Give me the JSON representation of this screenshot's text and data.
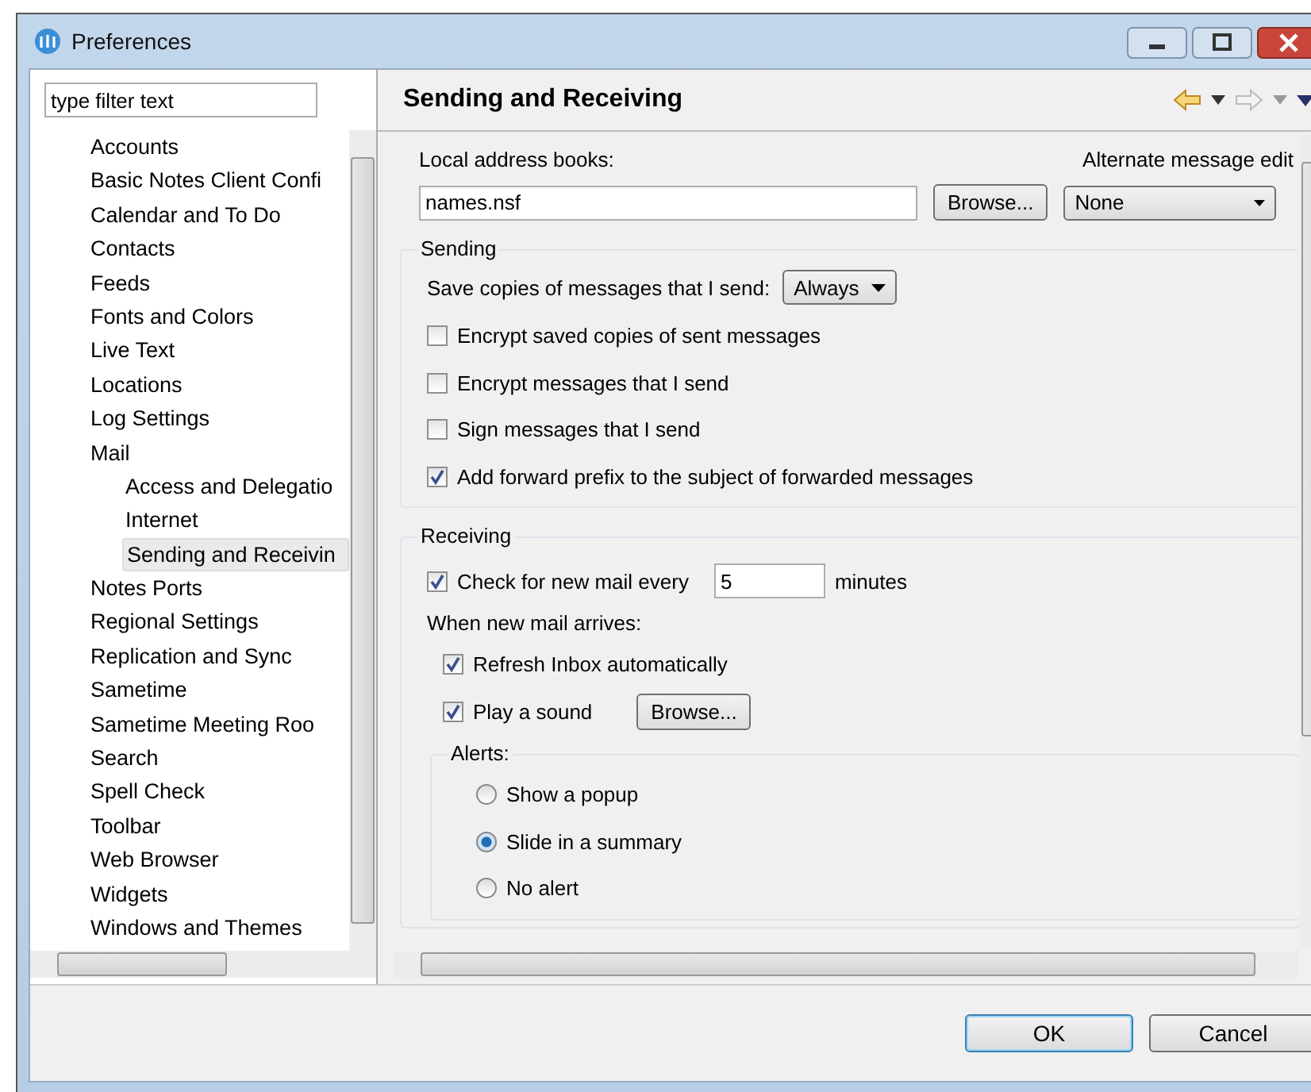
{
  "window": {
    "title": "Preferences"
  },
  "filter": {
    "placeholder": "type filter text"
  },
  "tree": [
    {
      "label": "Accounts",
      "selected": false
    },
    {
      "label": "Basic Notes Client Confi",
      "selected": false
    },
    {
      "label": "Calendar and To Do",
      "selected": false
    },
    {
      "label": "Contacts",
      "selected": false
    },
    {
      "label": "Feeds",
      "selected": false
    },
    {
      "label": "Fonts and Colors",
      "selected": false
    },
    {
      "label": "Live Text",
      "selected": false
    },
    {
      "label": "Locations",
      "selected": false
    },
    {
      "label": "Log Settings",
      "selected": false
    },
    {
      "label": "Mail",
      "selected": false,
      "children": [
        {
          "label": "Access and Delegatio",
          "selected": false
        },
        {
          "label": "Internet",
          "selected": false
        },
        {
          "label": "Sending and Receivin",
          "selected": true
        }
      ]
    },
    {
      "label": "Notes Ports",
      "selected": false
    },
    {
      "label": "Regional Settings",
      "selected": false
    },
    {
      "label": "Replication and Sync",
      "selected": false
    },
    {
      "label": "Sametime",
      "selected": false
    },
    {
      "label": "Sametime Meeting Roo",
      "selected": false
    },
    {
      "label": "Search",
      "selected": false
    },
    {
      "label": "Spell Check",
      "selected": false
    },
    {
      "label": "Toolbar",
      "selected": false
    },
    {
      "label": "Web Browser",
      "selected": false
    },
    {
      "label": "Widgets",
      "selected": false
    },
    {
      "label": "Windows and Themes",
      "selected": false
    }
  ],
  "page": {
    "title": "Sending and Receiving",
    "address": {
      "label": "Local address books:",
      "value": "names.nsf",
      "browse": "Browse...",
      "editor_label": "Alternate message edit",
      "editor_value": "None"
    },
    "sending": {
      "legend": "Sending",
      "save_label": "Save copies of messages that I send:",
      "save_value": "Always",
      "options": [
        {
          "label": "Encrypt saved copies of sent messages",
          "checked": false
        },
        {
          "label": "Encrypt messages that I send",
          "checked": false
        },
        {
          "label": "Sign messages that I send",
          "checked": false
        },
        {
          "label": "Add forward prefix to the subject of forwarded messages",
          "checked": true
        }
      ]
    },
    "receiving": {
      "legend": "Receiving",
      "check": {
        "label": "Check for new mail every",
        "checked": true,
        "value": "5",
        "unit": "minutes"
      },
      "arrives_label": "When new mail arrives:",
      "refresh": {
        "label": "Refresh Inbox automatically",
        "checked": true
      },
      "sound": {
        "label": "Play a sound",
        "checked": true,
        "browse": "Browse..."
      },
      "alerts": {
        "legend": "Alerts:",
        "options": [
          {
            "label": "Show a popup",
            "selected": false
          },
          {
            "label": "Slide in a summary",
            "selected": true
          },
          {
            "label": "No alert",
            "selected": false
          }
        ]
      }
    }
  },
  "buttons": [
    {
      "label": "OK",
      "default": true
    },
    {
      "label": "Cancel",
      "default": false
    }
  ]
}
